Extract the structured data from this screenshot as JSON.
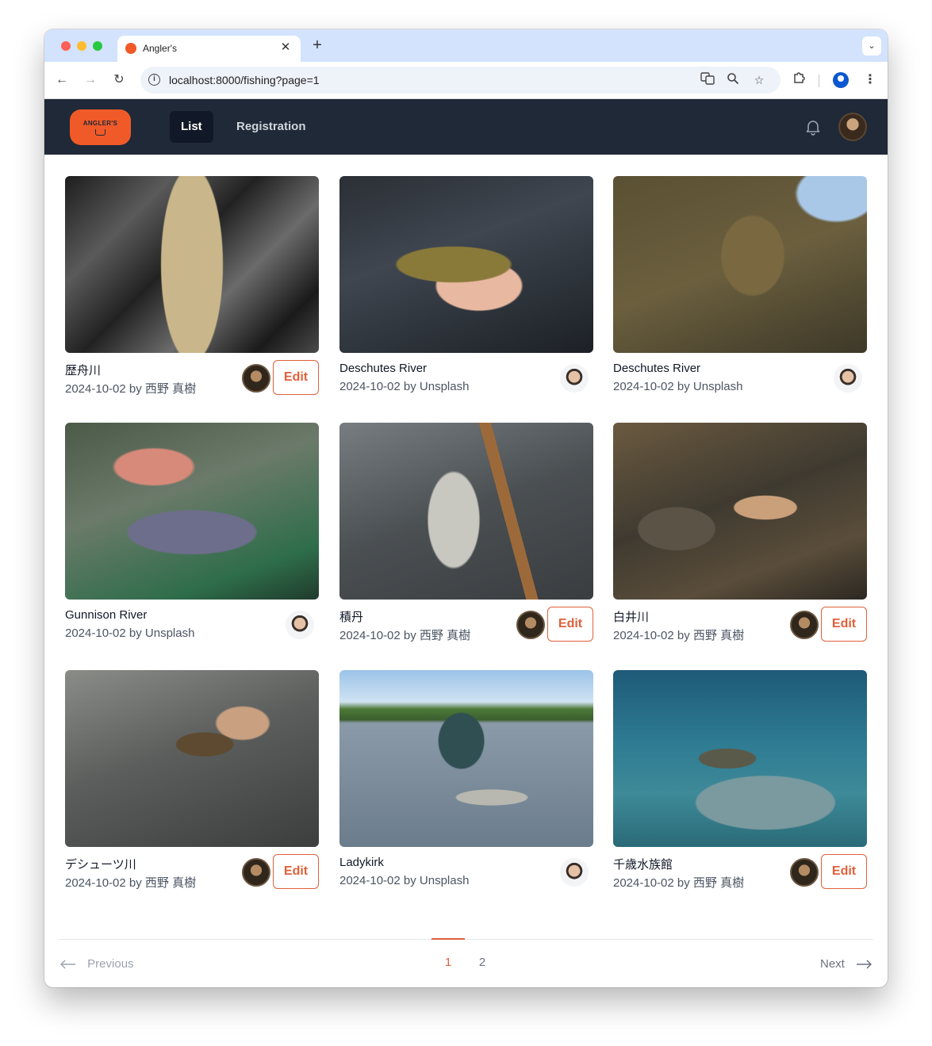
{
  "browser": {
    "tab_title": "Angler's",
    "url": "localhost:8000/fishing?page=1"
  },
  "header": {
    "logo_text": "ANGLER'S",
    "nav": [
      {
        "label": "List",
        "active": true
      },
      {
        "label": "Registration",
        "active": false
      }
    ]
  },
  "cards": [
    {
      "title": "歴舟川",
      "meta": "2024-10-02 by 西野 真樹",
      "owner": true,
      "edit_label": "Edit"
    },
    {
      "title": "Deschutes River",
      "meta": "2024-10-02 by Unsplash",
      "owner": false
    },
    {
      "title": "Deschutes River",
      "meta": "2024-10-02 by Unsplash",
      "owner": false
    },
    {
      "title": "Gunnison River",
      "meta": "2024-10-02 by Unsplash",
      "owner": false
    },
    {
      "title": "積丹",
      "meta": "2024-10-02 by 西野 真樹",
      "owner": true,
      "edit_label": "Edit"
    },
    {
      "title": "白井川",
      "meta": "2024-10-02 by 西野 真樹",
      "owner": true,
      "edit_label": "Edit"
    },
    {
      "title": "デシューツ川",
      "meta": "2024-10-02 by 西野 真樹",
      "owner": true,
      "edit_label": "Edit"
    },
    {
      "title": "Ladykirk",
      "meta": "2024-10-02 by Unsplash",
      "owner": false
    },
    {
      "title": "千歳水族館",
      "meta": "2024-10-02 by 西野 真樹",
      "owner": true,
      "edit_label": "Edit"
    }
  ],
  "pagination": {
    "previous": "Previous",
    "next": "Next",
    "pages": [
      "1",
      "2"
    ],
    "current": "1"
  },
  "colors": {
    "accent": "#e0603a",
    "header_bg": "#1f2937",
    "logo_bg": "#f05a28"
  }
}
